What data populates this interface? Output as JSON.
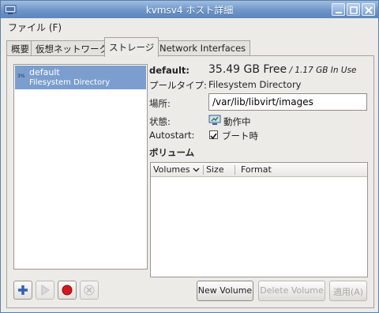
{
  "window": {
    "title": "kvmsv4 ホスト詳細"
  },
  "menu": {
    "file": "ファイル (F)"
  },
  "tabs": [
    "概要",
    "仮想ネットワーク",
    "ストレージ",
    "Network Interfaces"
  ],
  "pools": [
    {
      "percent": "3%",
      "name": "default",
      "type": "Filesystem Directory"
    }
  ],
  "details": {
    "name_label": "default:",
    "free_main": "35.49 GB Free",
    "free_sub": " / 1.17 GB In Use",
    "pool_type_label": "プールタイプ:",
    "pool_type_value": "Filesystem Directory",
    "location_label": "場所:",
    "location_value": "/var/lib/libvirt/images",
    "state_label": "状態:",
    "state_value": "動作中",
    "autostart_label": "Autostart:",
    "autostart_value": "ブート時",
    "volumes_heading": "ボリューム"
  },
  "volumes_table": {
    "columns": [
      "Volumes",
      "Size",
      "Format"
    ],
    "rows": []
  },
  "buttons": {
    "new_volume": "New Volume",
    "delete_volume": "Delete Volume",
    "apply": "適用(A)"
  },
  "colors": {
    "titlebar": "#6f96c8",
    "selection": "#7b9ece"
  },
  "icons": {
    "add": "plus-icon",
    "start": "play-icon",
    "stop": "record-stop-icon",
    "delete": "delete-circle-icon",
    "status": "monitor-running-icon"
  }
}
